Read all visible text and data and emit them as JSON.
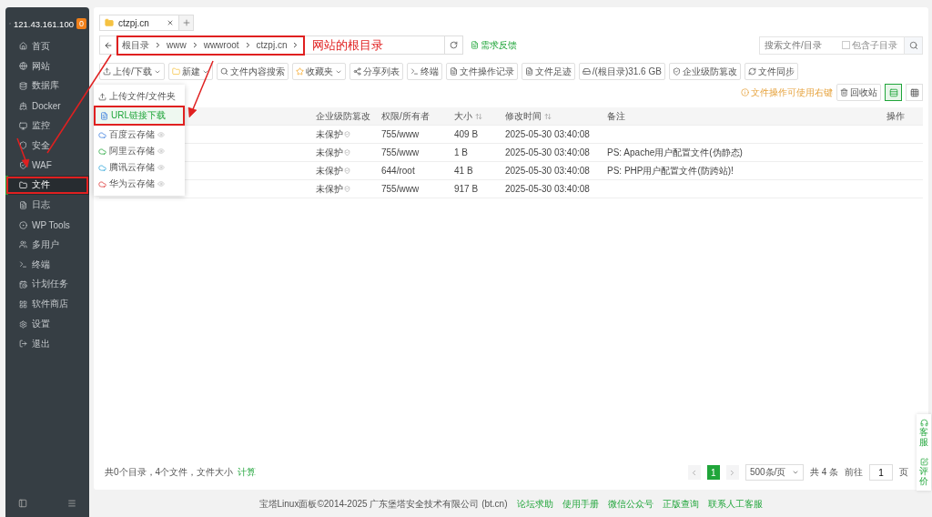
{
  "sidebar": {
    "host": "121.43.161.100",
    "badge": "0",
    "items": [
      {
        "label": "首页",
        "selected": false,
        "annotated": false
      },
      {
        "label": "网站",
        "selected": false,
        "annotated": false
      },
      {
        "label": "数据库",
        "selected": false,
        "annotated": false
      },
      {
        "label": "Docker",
        "selected": false,
        "annotated": false
      },
      {
        "label": "监控",
        "selected": false,
        "annotated": false
      },
      {
        "label": "安全",
        "selected": false,
        "annotated": false
      },
      {
        "label": "WAF",
        "selected": false,
        "annotated": false
      },
      {
        "label": "文件",
        "selected": true,
        "annotated": true
      },
      {
        "label": "日志",
        "selected": false,
        "annotated": false
      },
      {
        "label": "WP Tools",
        "selected": false,
        "annotated": false
      },
      {
        "label": "多用户",
        "selected": false,
        "annotated": false
      },
      {
        "label": "终端",
        "selected": false,
        "annotated": false
      },
      {
        "label": "计划任务",
        "selected": false,
        "annotated": false
      },
      {
        "label": "软件商店",
        "selected": false,
        "annotated": false
      },
      {
        "label": "设置",
        "selected": false,
        "annotated": false
      },
      {
        "label": "退出",
        "selected": false,
        "annotated": false
      }
    ]
  },
  "tabs": [
    {
      "label": "ctzpj.cn",
      "selected": true
    }
  ],
  "path": {
    "annotated": true,
    "crumbs": [
      "根目录",
      "www",
      "wwwroot",
      "ctzpj.cn"
    ],
    "feedback": "需求反馈",
    "note": "网站的根目录"
  },
  "search": {
    "placeholder": "搜索文件/目录",
    "subdir_label": "包含子目录",
    "subdir_checked": false
  },
  "toolbar": [
    {
      "label": "上传/下载",
      "kind": "dropdown"
    },
    {
      "label": "新建",
      "kind": "dropdown"
    },
    {
      "label": "文件内容搜索",
      "kind": "plain"
    },
    {
      "label": "收藏夹",
      "kind": "dropdown"
    },
    {
      "label": "分享列表",
      "kind": "plain"
    },
    {
      "label": "终端",
      "kind": "plain"
    },
    {
      "label": "文件操作记录",
      "kind": "plain"
    },
    {
      "label": "文件足迹",
      "kind": "plain"
    },
    {
      "label": "/(根目录)31.6 GB",
      "kind": "plain"
    },
    {
      "label": "企业级防篡改",
      "kind": "plain"
    },
    {
      "label": "文件同步",
      "kind": "plain"
    }
  ],
  "tip": "文件操作可使用右键",
  "recycle": "回收站",
  "views": [
    {
      "kind": "list",
      "selected": true
    },
    {
      "kind": "grid",
      "selected": false
    }
  ],
  "menu": [
    {
      "label": "上传文件/文件夹",
      "kind": "upload",
      "selected": false
    },
    {
      "label": "URL链接下载",
      "kind": "url",
      "selected": true
    },
    {
      "label": "百度云存储",
      "kind": "cloud",
      "selected": false
    },
    {
      "label": "阿里云存储",
      "kind": "cloud",
      "selected": false
    },
    {
      "label": "腾讯云存储",
      "kind": "cloud",
      "selected": false
    },
    {
      "label": "华为云存储",
      "kind": "cloud",
      "selected": false
    }
  ],
  "columns": [
    {
      "label": "企业级防篡改",
      "sortable": false
    },
    {
      "label": "权限/所有者",
      "sortable": false
    },
    {
      "label": "大小",
      "sortable": true
    },
    {
      "label": "修改时间",
      "sortable": true
    },
    {
      "label": "备注",
      "sortable": false
    },
    {
      "label": "操作",
      "sortable": false
    }
  ],
  "rows": [
    {
      "protect": "未保护",
      "perm": "755/www",
      "size": "409 B",
      "mtime": "2025-05-30 03:40:08"
    },
    {
      "protect": "未保护",
      "perm": "755/www",
      "size": "1 B",
      "mtime": "2025-05-30 03:40:08",
      "note": "PS: Apache用户配置文件(伪静态)"
    },
    {
      "protect": "未保护",
      "perm": "644/root",
      "size": "41 B",
      "mtime": "2025-05-30 03:40:08",
      "note": "PS: PHP用户配置文件(防跨站)!"
    },
    {
      "protect": "未保护",
      "perm": "755/www",
      "size": "917 B",
      "mtime": "2025-05-30 03:40:08"
    }
  ],
  "summary": {
    "text": "共0个目录，4个文件，文件大小",
    "link": "计算"
  },
  "pagination": {
    "current": "1",
    "per_page": "500条/页",
    "total": "共 4 条",
    "goto": "前往",
    "page_input": "1",
    "page_suffix": "页"
  },
  "float": [
    "客服",
    "评价"
  ],
  "footer": {
    "copyright": "宝塔Linux面板©2014-2025 广东堡塔安全技术有限公司 (bt.cn)",
    "links": [
      "论坛求助",
      "使用手册",
      "微信公众号",
      "正版查询",
      "联系人工客服"
    ]
  }
}
